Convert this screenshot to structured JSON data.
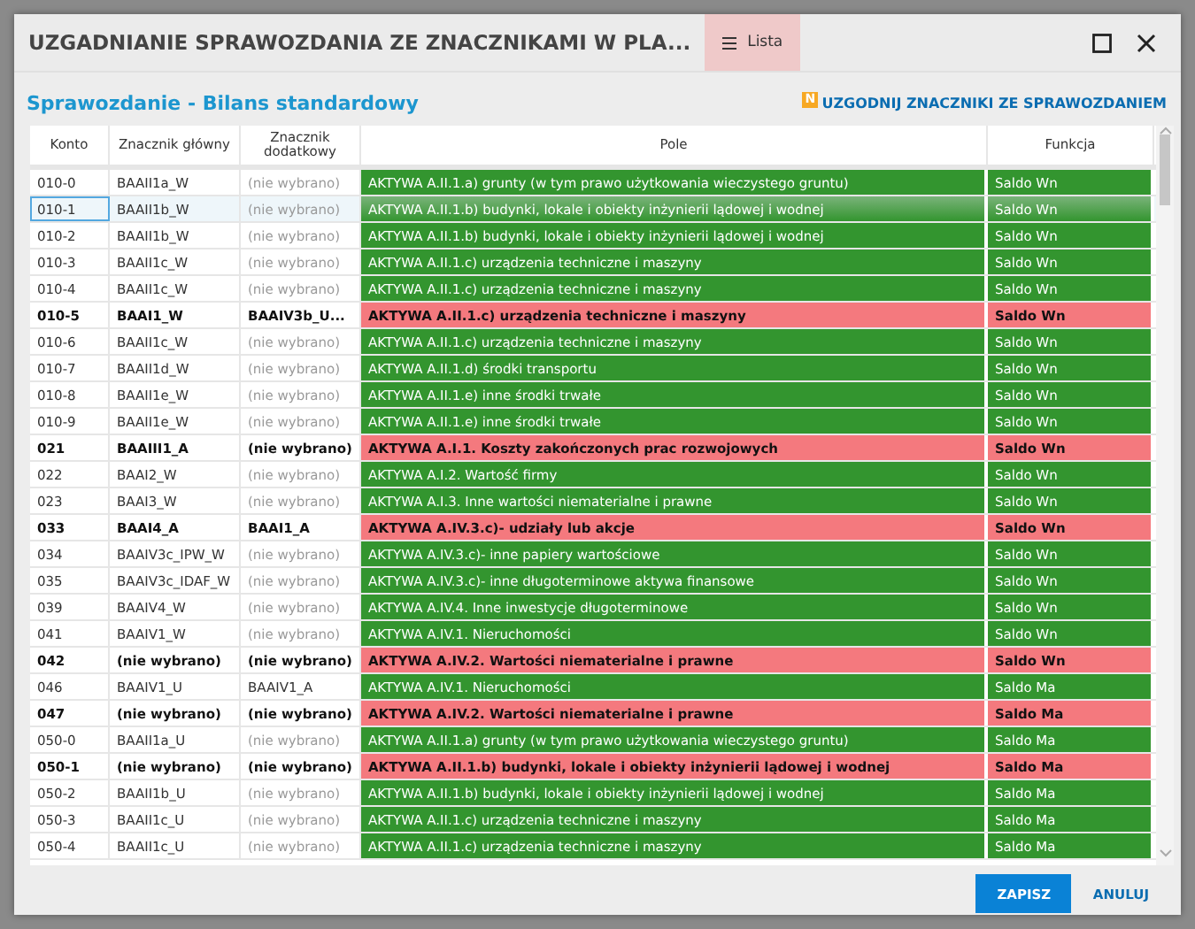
{
  "window": {
    "title": "UZGADNIANIE SPRAWOZDANIA ZE ZNACZNIKAMI W PLA...",
    "tab": {
      "label": "Lista",
      "selected": true
    }
  },
  "report_title": "Sprawozdanie - Bilans standardowy",
  "sync_link": {
    "badge": "N",
    "label": "UZGODNIJ ZNACZNIKI ZE SPRAWOZDANIEM"
  },
  "table": {
    "columns": [
      "Konto",
      "Znacznik główny",
      "Znacznik dodatkowy",
      "Pole",
      "Funkcja"
    ],
    "rows": [
      {
        "konto": "010-0",
        "main": "BAAII1a_W",
        "extra": "(nie wybrano)",
        "extra_chosen": false,
        "pole": "AKTYWA A.II.1.a) grunty (w tym prawo użytkowania wieczystego gruntu)",
        "funkcja": "Saldo Wn",
        "mismatch": false,
        "selected": false
      },
      {
        "konto": "010-1",
        "main": "BAAII1b_W",
        "extra": "(nie wybrano)",
        "extra_chosen": false,
        "pole": "AKTYWA A.II.1.b) budynki, lokale i obiekty inżynierii lądowej i wodnej",
        "funkcja": "Saldo Wn",
        "mismatch": false,
        "selected": true
      },
      {
        "konto": "010-2",
        "main": "BAAII1b_W",
        "extra": "(nie wybrano)",
        "extra_chosen": false,
        "pole": "AKTYWA A.II.1.b) budynki, lokale i obiekty inżynierii lądowej i wodnej",
        "funkcja": "Saldo Wn",
        "mismatch": false,
        "selected": false
      },
      {
        "konto": "010-3",
        "main": "BAAII1c_W",
        "extra": "(nie wybrano)",
        "extra_chosen": false,
        "pole": "AKTYWA A.II.1.c) urządzenia techniczne i maszyny",
        "funkcja": "Saldo Wn",
        "mismatch": false,
        "selected": false
      },
      {
        "konto": "010-4",
        "main": "BAAII1c_W",
        "extra": "(nie wybrano)",
        "extra_chosen": false,
        "pole": "AKTYWA A.II.1.c) urządzenia techniczne i maszyny",
        "funkcja": "Saldo Wn",
        "mismatch": false,
        "selected": false
      },
      {
        "konto": "010-5",
        "main": "BAAI1_W",
        "extra": "BAAIV3b_U...",
        "pole": "AKTYWA A.II.1.c) urządzenia techniczne i maszyny",
        "funkcja": "Saldo Wn",
        "mismatch": true,
        "selected": false
      },
      {
        "konto": "010-6",
        "main": "BAAII1c_W",
        "extra": "(nie wybrano)",
        "extra_chosen": false,
        "pole": "AKTYWA A.II.1.c) urządzenia techniczne i maszyny",
        "funkcja": "Saldo Wn",
        "mismatch": false,
        "selected": false
      },
      {
        "konto": "010-7",
        "main": "BAAII1d_W",
        "extra": "(nie wybrano)",
        "extra_chosen": false,
        "pole": "AKTYWA A.II.1.d) środki transportu",
        "funkcja": "Saldo Wn",
        "mismatch": false,
        "selected": false
      },
      {
        "konto": "010-8",
        "main": "BAAII1e_W",
        "extra": "(nie wybrano)",
        "extra_chosen": false,
        "pole": "AKTYWA A.II.1.e) inne środki trwałe",
        "funkcja": "Saldo Wn",
        "mismatch": false,
        "selected": false
      },
      {
        "konto": "010-9",
        "main": "BAAII1e_W",
        "extra": "(nie wybrano)",
        "extra_chosen": false,
        "pole": "AKTYWA A.II.1.e) inne środki trwałe",
        "funkcja": "Saldo Wn",
        "mismatch": false,
        "selected": false
      },
      {
        "konto": "021",
        "main": "BAAIII1_A",
        "extra": "(nie wybrano)",
        "pole": "AKTYWA A.I.1. Koszty zakończonych prac rozwojowych",
        "funkcja": "Saldo Wn",
        "mismatch": true,
        "selected": false
      },
      {
        "konto": "022",
        "main": "BAAI2_W",
        "extra": "(nie wybrano)",
        "extra_chosen": false,
        "pole": "AKTYWA A.I.2. Wartość firmy",
        "funkcja": "Saldo Wn",
        "mismatch": false,
        "selected": false
      },
      {
        "konto": "023",
        "main": "BAAI3_W",
        "extra": "(nie wybrano)",
        "extra_chosen": false,
        "pole": "AKTYWA A.I.3. Inne wartości niematerialne i prawne",
        "funkcja": "Saldo Wn",
        "mismatch": false,
        "selected": false
      },
      {
        "konto": "033",
        "main": "BAAI4_A",
        "extra": "BAAI1_A",
        "pole": "AKTYWA A.IV.3.c)- udziały lub akcje",
        "funkcja": "Saldo Wn",
        "mismatch": true,
        "selected": false
      },
      {
        "konto": "034",
        "main": "BAAIV3c_IPW_W",
        "extra": "(nie wybrano)",
        "extra_chosen": false,
        "pole": "AKTYWA A.IV.3.c)- inne papiery wartościowe",
        "funkcja": "Saldo Wn",
        "mismatch": false,
        "selected": false
      },
      {
        "konto": "035",
        "main": "BAAIV3c_IDAF_W",
        "extra": "(nie wybrano)",
        "extra_chosen": false,
        "pole": "AKTYWA A.IV.3.c)- inne długoterminowe aktywa finansowe",
        "funkcja": "Saldo Wn",
        "mismatch": false,
        "selected": false
      },
      {
        "konto": "039",
        "main": "BAAIV4_W",
        "extra": "(nie wybrano)",
        "extra_chosen": false,
        "pole": "AKTYWA A.IV.4. Inne inwestycje długoterminowe",
        "funkcja": "Saldo Wn",
        "mismatch": false,
        "selected": false
      },
      {
        "konto": "041",
        "main": "BAAIV1_W",
        "extra": "(nie wybrano)",
        "extra_chosen": false,
        "pole": "AKTYWA A.IV.1. Nieruchomości",
        "funkcja": "Saldo Wn",
        "mismatch": false,
        "selected": false
      },
      {
        "konto": "042",
        "main": "(nie wybrano)",
        "extra": "(nie wybrano)",
        "pole": "AKTYWA A.IV.2. Wartości niematerialne i prawne",
        "funkcja": "Saldo Wn",
        "mismatch": true,
        "selected": false
      },
      {
        "konto": "046",
        "main": "BAAIV1_U",
        "extra": "BAAIV1_A",
        "extra_chosen": true,
        "pole": "AKTYWA A.IV.1. Nieruchomości",
        "funkcja": "Saldo Ma",
        "mismatch": false,
        "selected": false
      },
      {
        "konto": "047",
        "main": "(nie wybrano)",
        "extra": "(nie wybrano)",
        "pole": "AKTYWA A.IV.2. Wartości niematerialne i prawne",
        "funkcja": "Saldo Ma",
        "mismatch": true,
        "selected": false
      },
      {
        "konto": "050-0",
        "main": "BAAII1a_U",
        "extra": "(nie wybrano)",
        "extra_chosen": false,
        "pole": "AKTYWA A.II.1.a) grunty (w tym prawo użytkowania wieczystego gruntu)",
        "funkcja": "Saldo Ma",
        "mismatch": false,
        "selected": false
      },
      {
        "konto": "050-1",
        "main": "(nie wybrano)",
        "extra": "(nie wybrano)",
        "pole": "AKTYWA A.II.1.b) budynki, lokale i obiekty inżynierii lądowej i wodnej",
        "funkcja": "Saldo Ma",
        "mismatch": true,
        "selected": false
      },
      {
        "konto": "050-2",
        "main": "BAAII1b_U",
        "extra": "(nie wybrano)",
        "extra_chosen": false,
        "pole": "AKTYWA A.II.1.b) budynki, lokale i obiekty inżynierii lądowej i wodnej",
        "funkcja": "Saldo Ma",
        "mismatch": false,
        "selected": false
      },
      {
        "konto": "050-3",
        "main": "BAAII1c_U",
        "extra": "(nie wybrano)",
        "extra_chosen": false,
        "pole": "AKTYWA A.II.1.c) urządzenia techniczne i maszyny",
        "funkcja": "Saldo Ma",
        "mismatch": false,
        "selected": false
      },
      {
        "konto": "050-4",
        "main": "BAAII1c_U",
        "extra": "(nie wybrano)",
        "extra_chosen": false,
        "pole": "AKTYWA A.II.1.c) urządzenia techniczne i maszyny",
        "funkcja": "Saldo Ma",
        "mismatch": false,
        "selected": false
      }
    ]
  },
  "buttons": [
    {
      "label": "ZAPISZ",
      "kind": "primary"
    },
    {
      "label": "ANULUJ",
      "kind": "link"
    }
  ]
}
